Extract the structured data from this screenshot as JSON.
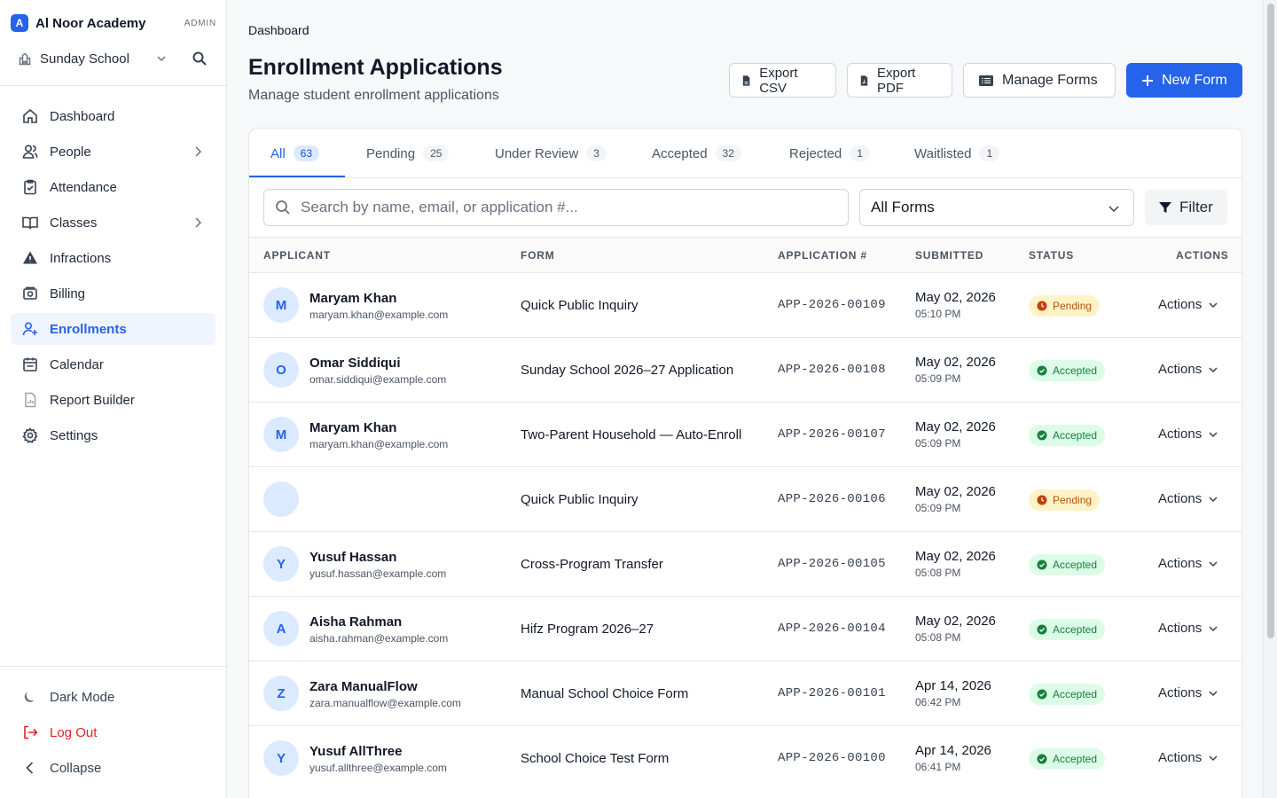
{
  "app": {
    "brand_initial": "A",
    "brand_name": "Al Noor Academy",
    "role": "ADMIN",
    "school": "Sunday School"
  },
  "sidebar": {
    "items": [
      {
        "label": "Dashboard",
        "icon": "home-icon"
      },
      {
        "label": "People",
        "icon": "users-icon",
        "has_children": true
      },
      {
        "label": "Attendance",
        "icon": "clipboard-check-icon"
      },
      {
        "label": "Classes",
        "icon": "book-open-icon",
        "has_children": true
      },
      {
        "label": "Infractions",
        "icon": "warning-icon"
      },
      {
        "label": "Billing",
        "icon": "billing-icon"
      },
      {
        "label": "Enrollments",
        "icon": "user-plus-icon",
        "active": true
      },
      {
        "label": "Calendar",
        "icon": "calendar-icon"
      },
      {
        "label": "Report Builder",
        "icon": "report-icon"
      },
      {
        "label": "Settings",
        "icon": "gear-icon"
      }
    ],
    "bottom": [
      {
        "label": "Dark Mode",
        "icon": "moon-icon"
      },
      {
        "label": "Log Out",
        "icon": "logout-icon"
      },
      {
        "label": "Collapse",
        "icon": "chevron-left-icon"
      }
    ]
  },
  "header": {
    "breadcrumb": "Dashboard",
    "title": "Enrollment Applications",
    "subtitle": "Manage student enrollment applications",
    "buttons": {
      "export_csv": "Export CSV",
      "export_pdf": "Export PDF",
      "manage_forms": "Manage Forms",
      "new_form": "New Form"
    }
  },
  "tabs": [
    {
      "label": "All",
      "count": "63",
      "active": true
    },
    {
      "label": "Pending",
      "count": "25"
    },
    {
      "label": "Under Review",
      "count": "3"
    },
    {
      "label": "Accepted",
      "count": "32"
    },
    {
      "label": "Rejected",
      "count": "1"
    },
    {
      "label": "Waitlisted",
      "count": "1"
    }
  ],
  "filters": {
    "search_placeholder": "Search by name, email, or application #...",
    "form_select": "All Forms",
    "filter_label": "Filter"
  },
  "table": {
    "columns": [
      "APPLICANT",
      "FORM",
      "APPLICATION #",
      "SUBMITTED",
      "STATUS",
      "ACTIONS"
    ],
    "action_label": "Actions",
    "rows": [
      {
        "initial": "M",
        "name": "Maryam Khan",
        "email": "maryam.khan@example.com",
        "form": "Quick Public Inquiry",
        "app_no": "APP-2026-00109",
        "date": "May 02, 2026",
        "time": "05:10 PM",
        "status": "Pending"
      },
      {
        "initial": "O",
        "name": "Omar Siddiqui",
        "email": "omar.siddiqui@example.com",
        "form": "Sunday School 2026–27 Application",
        "app_no": "APP-2026-00108",
        "date": "May 02, 2026",
        "time": "05:09 PM",
        "status": "Accepted"
      },
      {
        "initial": "M",
        "name": "Maryam Khan",
        "email": "maryam.khan@example.com",
        "form": "Two-Parent Household — Auto-Enroll",
        "app_no": "APP-2026-00107",
        "date": "May 02, 2026",
        "time": "05:09 PM",
        "status": "Accepted"
      },
      {
        "initial": "",
        "name": "",
        "email": "",
        "form": "Quick Public Inquiry",
        "app_no": "APP-2026-00106",
        "date": "May 02, 2026",
        "time": "05:09 PM",
        "status": "Pending"
      },
      {
        "initial": "Y",
        "name": "Yusuf Hassan",
        "email": "yusuf.hassan@example.com",
        "form": "Cross-Program Transfer",
        "app_no": "APP-2026-00105",
        "date": "May 02, 2026",
        "time": "05:08 PM",
        "status": "Accepted"
      },
      {
        "initial": "A",
        "name": "Aisha Rahman",
        "email": "aisha.rahman@example.com",
        "form": "Hifz Program 2026–27",
        "app_no": "APP-2026-00104",
        "date": "May 02, 2026",
        "time": "05:08 PM",
        "status": "Accepted"
      },
      {
        "initial": "Z",
        "name": "Zara ManualFlow",
        "email": "zara.manualflow@example.com",
        "form": "Manual School Choice Form",
        "app_no": "APP-2026-00101",
        "date": "Apr 14, 2026",
        "time": "06:42 PM",
        "status": "Accepted"
      },
      {
        "initial": "Y",
        "name": "Yusuf AllThree",
        "email": "yusuf.allthree@example.com",
        "form": "School Choice Test Form",
        "app_no": "APP-2026-00100",
        "date": "Apr 14, 2026",
        "time": "06:41 PM",
        "status": "Accepted"
      }
    ]
  },
  "colors": {
    "accent": "#2563eb",
    "pending_bg": "#fef3c7",
    "pending_text": "#b45309",
    "accepted_bg": "#dcfce7",
    "accepted_text": "#15803d",
    "danger": "#dc2626"
  }
}
